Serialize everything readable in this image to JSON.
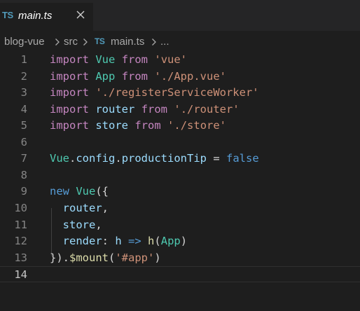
{
  "tab": {
    "icon_label": "TS",
    "title": "main.ts",
    "close_glyph": "close-icon"
  },
  "breadcrumb": {
    "items": [
      "blog-vue",
      "src",
      "main.ts",
      "..."
    ],
    "file_icon_label": "TS"
  },
  "editor": {
    "language": "TypeScript",
    "current_line": 14,
    "line_numbers": [
      "1",
      "2",
      "3",
      "4",
      "5",
      "6",
      "7",
      "8",
      "9",
      "10",
      "11",
      "12",
      "13",
      "14"
    ],
    "lines": [
      [
        [
          "kw",
          "import"
        ],
        [
          "pl",
          " "
        ],
        [
          "cls",
          "Vue"
        ],
        [
          "pl",
          " "
        ],
        [
          "kw",
          "from"
        ],
        [
          "pl",
          " "
        ],
        [
          "str",
          "'vue'"
        ]
      ],
      [
        [
          "kw",
          "import"
        ],
        [
          "pl",
          " "
        ],
        [
          "cls",
          "App"
        ],
        [
          "pl",
          " "
        ],
        [
          "kw",
          "from"
        ],
        [
          "pl",
          " "
        ],
        [
          "str",
          "'./App.vue'"
        ]
      ],
      [
        [
          "kw",
          "import"
        ],
        [
          "pl",
          " "
        ],
        [
          "str",
          "'./registerServiceWorker'"
        ]
      ],
      [
        [
          "kw",
          "import"
        ],
        [
          "pl",
          " "
        ],
        [
          "var",
          "router"
        ],
        [
          "pl",
          " "
        ],
        [
          "kw",
          "from"
        ],
        [
          "pl",
          " "
        ],
        [
          "str",
          "'./router'"
        ]
      ],
      [
        [
          "kw",
          "import"
        ],
        [
          "pl",
          " "
        ],
        [
          "var",
          "store"
        ],
        [
          "pl",
          " "
        ],
        [
          "kw",
          "from"
        ],
        [
          "pl",
          " "
        ],
        [
          "str",
          "'./store'"
        ]
      ],
      [],
      [
        [
          "cls",
          "Vue"
        ],
        [
          "pl",
          "."
        ],
        [
          "var",
          "config"
        ],
        [
          "pl",
          "."
        ],
        [
          "var",
          "productionTip"
        ],
        [
          "pl",
          " = "
        ],
        [
          "kwb",
          "false"
        ]
      ],
      [],
      [
        [
          "kwb",
          "new"
        ],
        [
          "pl",
          " "
        ],
        [
          "cls",
          "Vue"
        ],
        [
          "pl",
          "({"
        ]
      ],
      [
        [
          "pl",
          "  "
        ],
        [
          "var",
          "router"
        ],
        [
          "pl",
          ","
        ]
      ],
      [
        [
          "pl",
          "  "
        ],
        [
          "var",
          "store"
        ],
        [
          "pl",
          ","
        ]
      ],
      [
        [
          "pl",
          "  "
        ],
        [
          "var",
          "render"
        ],
        [
          "pl",
          ": "
        ],
        [
          "var",
          "h"
        ],
        [
          "pl",
          " "
        ],
        [
          "kwb",
          "=>"
        ],
        [
          "pl",
          " "
        ],
        [
          "fn",
          "h"
        ],
        [
          "pl",
          "("
        ],
        [
          "cls",
          "App"
        ],
        [
          "pl",
          ")"
        ]
      ],
      [
        [
          "pl",
          "})."
        ],
        [
          "fn",
          "$mount"
        ],
        [
          "pl",
          "("
        ],
        [
          "str",
          "'#app'"
        ],
        [
          "pl",
          ")"
        ]
      ],
      []
    ]
  },
  "colors": {
    "background": "#1e1e1e",
    "tabbar": "#252526",
    "ts_icon": "#519aba",
    "keyword_control": "#c586c0",
    "keyword": "#569cd6",
    "string": "#ce9178",
    "class": "#4ec9b0",
    "variable": "#9cdcfe",
    "function": "#dcdcaa",
    "plain": "#d4d4d4",
    "line_number": "#858585"
  }
}
